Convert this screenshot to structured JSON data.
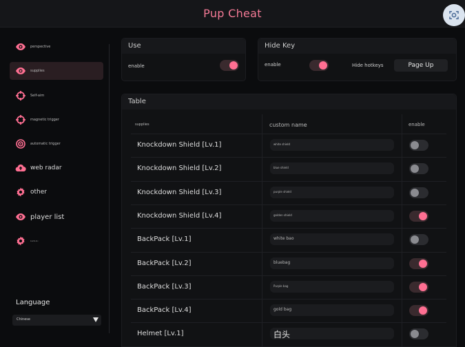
{
  "app": {
    "title": "Pup Cheat",
    "corner_icon": "screen-capture-icon"
  },
  "colors": {
    "accent": "#ff6f92",
    "title": "#f47a96",
    "background": "#0b0c0e",
    "panel": "#111214"
  },
  "sidebar": {
    "items": [
      {
        "label": "perspective",
        "icon": "eye-icon",
        "active": false
      },
      {
        "label": "supplies",
        "icon": "eye-icon",
        "active": true
      },
      {
        "label": "Self-aim",
        "icon": "crosshair-icon",
        "active": false
      },
      {
        "label": "magnetic trigger",
        "icon": "crosshair-icon",
        "active": false
      },
      {
        "label": "automatic trigger",
        "icon": "target-icon",
        "active": false
      },
      {
        "label": "web radar",
        "icon": "cloud-upload-icon",
        "active": false
      },
      {
        "label": "other",
        "icon": "gear-icon",
        "active": false
      },
      {
        "label": "player list",
        "icon": "eye-icon",
        "active": false
      },
      {
        "label": "1:2:1:1:",
        "icon": "gear-icon",
        "active": false
      }
    ]
  },
  "language": {
    "title": "Language",
    "selected": "Chinese"
  },
  "use_panel": {
    "title": "Use",
    "enable_label": "enable",
    "enabled": true
  },
  "hidekey_panel": {
    "title": "Hide Key",
    "enable_label": "enable",
    "enabled": true,
    "hotkeys_label": "Hide hotkeys",
    "hotkey_value": "Page Up"
  },
  "table_panel": {
    "title": "Table",
    "columns": [
      "supplies",
      "custom name",
      "enable"
    ],
    "rows": [
      {
        "name": "Knockdown Shield [Lv.1]",
        "custom": "white shield",
        "enabled": false
      },
      {
        "name": "Knockdown Shield [Lv.2]",
        "custom": "blue shield",
        "enabled": false
      },
      {
        "name": "Knockdown Shield [Lv.3]",
        "custom": "purple shield",
        "enabled": false
      },
      {
        "name": "Knockdown Shield [Lv.4]",
        "custom": "golden shield",
        "enabled": true
      },
      {
        "name": "BackPack [Lv.1]",
        "custom": "white bao",
        "enabled": false
      },
      {
        "name": "BackPack [Lv.2]",
        "custom": "bluebag",
        "enabled": true
      },
      {
        "name": "BackPack [Lv.3]",
        "custom": "Purple bag",
        "enabled": true
      },
      {
        "name": "BackPack [Lv.4]",
        "custom": "gold bag",
        "enabled": true
      },
      {
        "name": "Helmet [Lv.1]",
        "custom": "白头",
        "enabled": false
      }
    ]
  }
}
